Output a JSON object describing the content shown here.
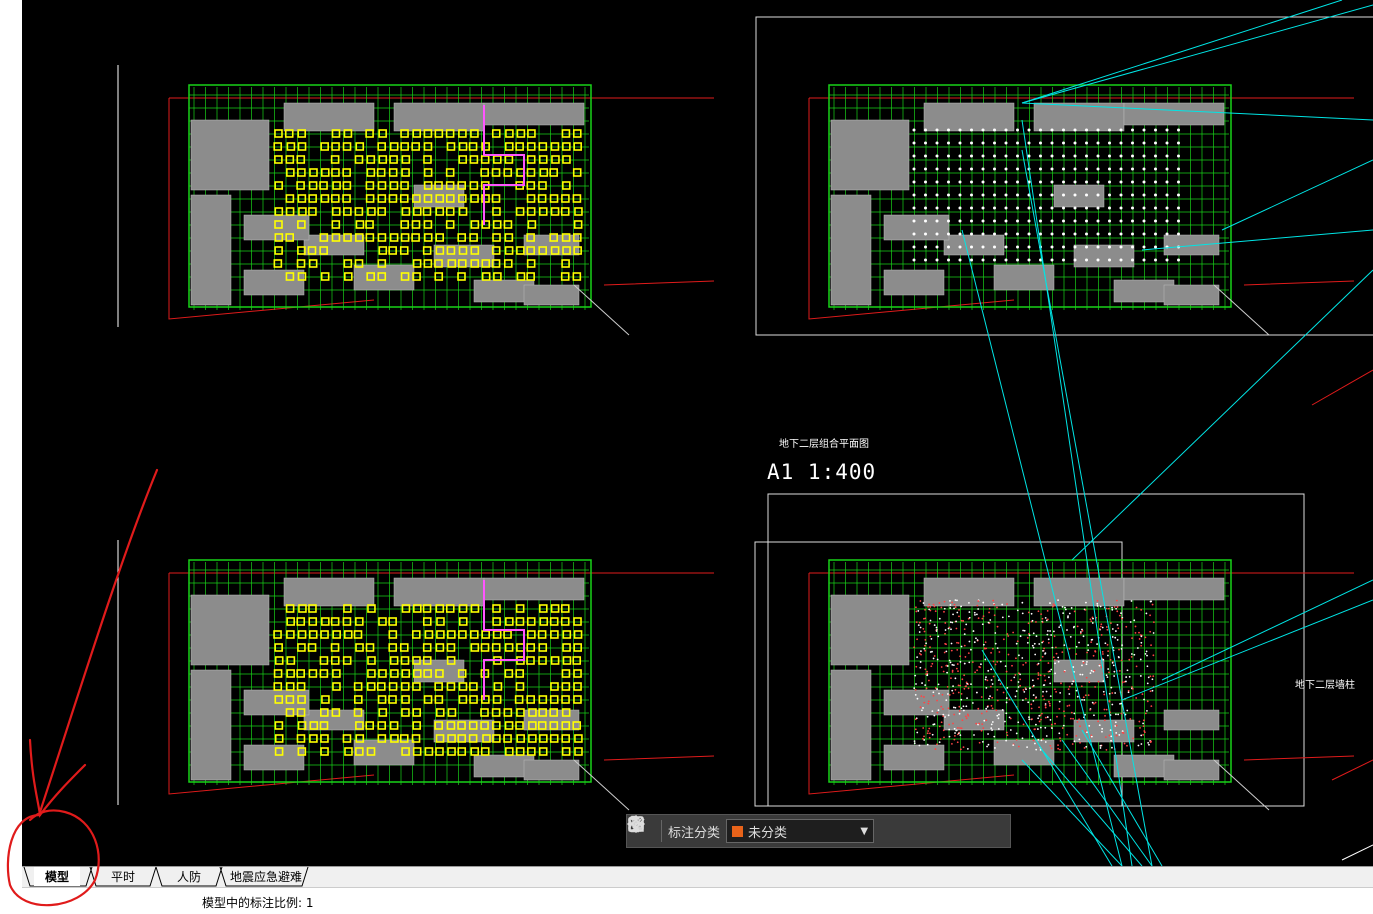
{
  "drawing": {
    "sheet_title": "地下二层组合平面图",
    "scale_text": "A1  1:400",
    "side_note": "地下二层墙柱",
    "small_label": "地下二层"
  },
  "toolbar": {
    "grid_icon": "grid-icon",
    "label": "标注分类",
    "selected_category": "未分类",
    "category_color": "#e8631a",
    "edit_icon": "edit-icon",
    "move_icon": "move-icon",
    "copy_icon": "copy-icon",
    "paste_icon": "paste-icon"
  },
  "tabs": [
    {
      "label": "模型",
      "active": true
    },
    {
      "label": "平时",
      "active": false
    },
    {
      "label": "人防",
      "active": false
    },
    {
      "label": "地震应急避难",
      "active": false
    }
  ],
  "status": {
    "text": "模型中的标注比例: 1"
  },
  "colors": {
    "background": "#000000",
    "grid": "#19d219",
    "outline": "#e01b1b",
    "fill": "#8c8c8c",
    "columns": "#ffff00",
    "leader": "#00e5e5",
    "annotation": "#e01b1b"
  }
}
